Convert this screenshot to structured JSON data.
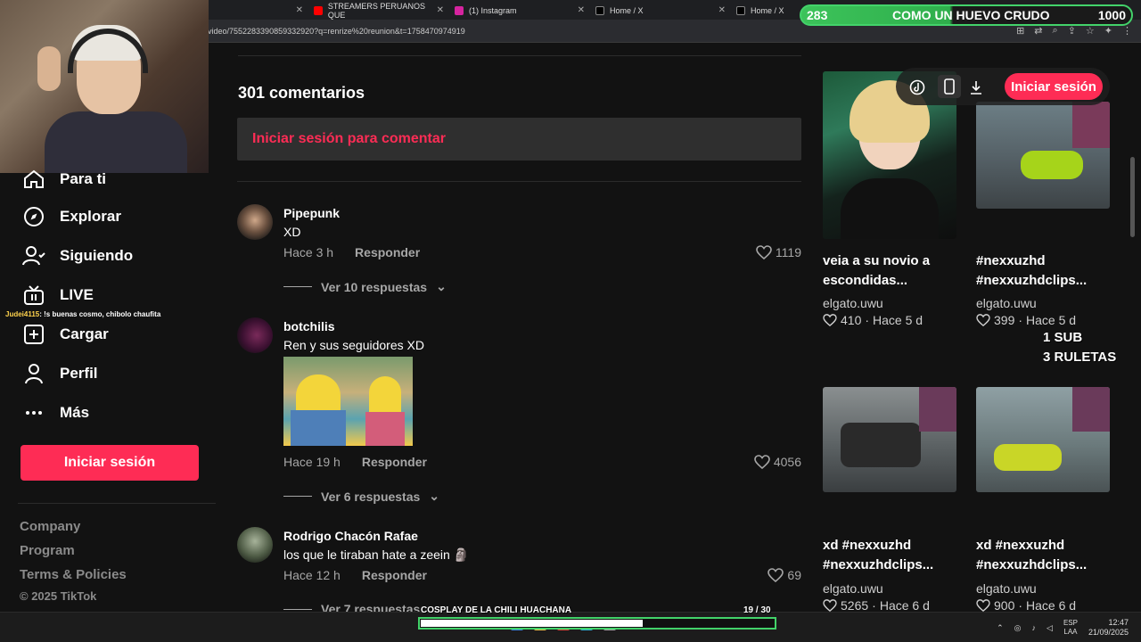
{
  "browser": {
    "tabs": [
      {
        "label": "",
        "icon": "tiktok-icon"
      },
      {
        "label": "STREAMERS PERUANOS QUE",
        "icon": "youtube-icon",
        "color": "#ff0000"
      },
      {
        "label": "(1) Instagram",
        "icon": "instagram-icon",
        "color": "#d6249f"
      },
      {
        "label": "Home / X",
        "icon": "x-icon"
      },
      {
        "label": "Home / X",
        "icon": "x-icon"
      }
    ],
    "url": "video/7552283390859332920?q=renrize%20reunion&t=1758470974919"
  },
  "stream_overlay": {
    "left_value": "283",
    "title": "COMO UN HUEVO CRUDO",
    "right_value": "1000",
    "sub_line1": "1 SUB",
    "sub_line2": "3 RULETAS",
    "chat_user": "Judei4115",
    "chat_message": ": !s buenas cosmo, chibolo chaufita",
    "progress_label": "COSPLAY DE LA CHILI HUACHANA",
    "progress_count": "19 / 30",
    "progress_fraction": 0.63
  },
  "sidebar": {
    "items": [
      {
        "label": "Para ti",
        "icon": "home-icon"
      },
      {
        "label": "Explorar",
        "icon": "compass-icon"
      },
      {
        "label": "Siguiendo",
        "icon": "following-icon"
      },
      {
        "label": "LIVE",
        "icon": "live-icon"
      },
      {
        "label": "Cargar",
        "icon": "upload-icon"
      },
      {
        "label": "Perfil",
        "icon": "profile-icon"
      },
      {
        "label": "Más",
        "icon": "more-icon"
      }
    ],
    "login_label": "Iniciar sesión",
    "footer": [
      "Company",
      "Program",
      "Terms & Policies"
    ],
    "copyright": "© 2025 TikTok"
  },
  "comments": {
    "count_label": "301 comentarios",
    "login_prompt": "Iniciar sesión para comentar",
    "items": [
      {
        "user": "Pipepunk",
        "text": "XD",
        "time": "Hace 3 h",
        "reply": "Responder",
        "likes": "1119",
        "replies": "Ver 10 respuestas"
      },
      {
        "user": "botchilis",
        "text": "Ren y sus seguidores XD",
        "time": "Hace 19 h",
        "reply": "Responder",
        "likes": "4056",
        "replies": "Ver 6 respuestas"
      },
      {
        "user": "Rodrigo Chacón Rafae",
        "text": "los que le tiraban hate a zeein 🗿",
        "time": "Hace 12 h",
        "reply": "Responder",
        "likes": "69",
        "replies": "Ver 7 respuestas"
      }
    ]
  },
  "recommendations": {
    "login_label": "Iniciar sesión",
    "items": [
      {
        "title": "veia a su novio a escondidas...",
        "author": "elgato.uwu",
        "likes": "410",
        "age": "Hace 5 d"
      },
      {
        "title": "#nexxuzhd #nexxuzhdclips...",
        "author": "elgato.uwu",
        "likes": "399",
        "age": "Hace 5 d"
      },
      {
        "title": "xd #nexxuzhd #nexxuzhdclips...",
        "author": "elgato.uwu",
        "likes": "5265",
        "age": "Hace 6 d"
      },
      {
        "title": "xd #nexxuzhd #nexxuzhdclips...",
        "author": "elgato.uwu",
        "likes": "900",
        "age": "Hace 6 d"
      }
    ]
  },
  "taskbar": {
    "lang_top": "ESP",
    "lang_bottom": "LAA",
    "time": "12:47",
    "date": "21/09/2025"
  }
}
